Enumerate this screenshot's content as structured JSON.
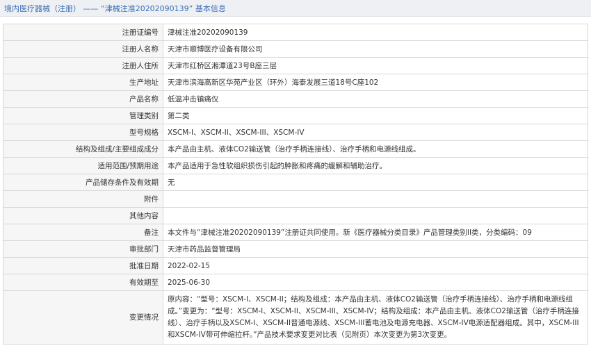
{
  "header": {
    "title": "境内医疗器械（注册） —— “津械注准20202090139” 基本信息"
  },
  "rows": [
    {
      "label": "注册证编号",
      "value": "津械注准20202090139"
    },
    {
      "label": "注册人名称",
      "value": "天津市顺博医疗设备有限公司"
    },
    {
      "label": "注册人住所",
      "value": "天津市红桥区湘潭道23号B座三层"
    },
    {
      "label": "生产地址",
      "value": "天津市滨海高新区华苑产业区（环外）海泰发展三道18号C座102"
    },
    {
      "label": "产品名称",
      "value": "低温冲击镇痛仪"
    },
    {
      "label": "管理类别",
      "value": "第二类"
    },
    {
      "label": "型号规格",
      "value": "XSCM-I、XSCM-II、XSCM-III、XSCM-IV"
    },
    {
      "label": "结构及组成/主要组成成分",
      "value": "本产品由主机、液体CO2输送管（治疗手柄连接线）、治疗手柄和电源线组成。"
    },
    {
      "label": "适用范围/预期用途",
      "value": "本产品适用于急性软组织损伤引起的肿胀和疼痛的缓解和辅助治疗。"
    },
    {
      "label": "产品储存条件及有效期",
      "value": "无"
    },
    {
      "label": "附件",
      "value": ""
    },
    {
      "label": "其他内容",
      "value": ""
    },
    {
      "label": "备注",
      "value": "本文件与“津械注准20202090139”注册证共同使用。新《医疗器械分类目录》产品管理类别II类，分类编码：09"
    },
    {
      "label": "审批部门",
      "value": "天津市药品监督管理局"
    },
    {
      "label": "批准日期",
      "value": "2022-02-15"
    },
    {
      "label": "有效期至",
      "value": "2025-06-30"
    },
    {
      "label": "变更情况",
      "value": "原内容：“型号：XSCM-I、XSCM-II；结构及组成：本产品由主机、液体CO2输送管（治疗手柄连接线）、治疗手柄和电源线组成。”变更为：“型号：XSCM-I、XSCM-II、XSCM-III、XSCM-IV；结构及组成：本产品由主机、液体CO2输送管（治疗手柄连接线）、治疗手柄以及XSCM-I、XSCM-II普通电源线、XSCM-III蓄电池及电源充电器、XSCM-IV电源适配器组成。其中，XSCM-III和XSCM-IV带可伸缩拉杆。”产品技术要求变更对比表（见附页）本次变更为第3次变更。"
    }
  ]
}
